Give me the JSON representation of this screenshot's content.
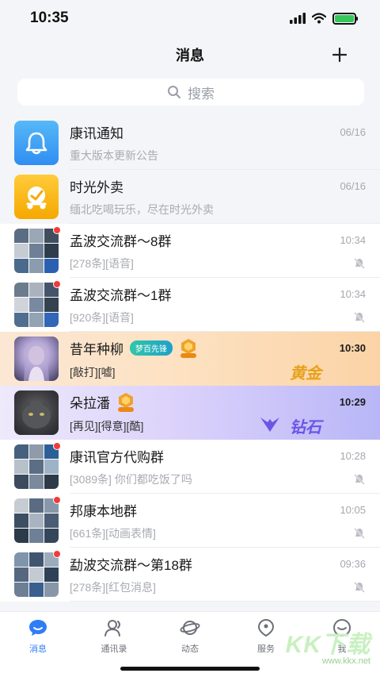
{
  "status_bar": {
    "time": "10:35"
  },
  "nav": {
    "title": "消息",
    "add_icon": "plus-icon"
  },
  "search": {
    "placeholder": "搜索"
  },
  "conversations": [
    {
      "name": "康讯通知",
      "preview": "重大版本更新公告",
      "time": "06/16",
      "avatar": "bell-app-icon",
      "pinned": true
    },
    {
      "name": "时光外卖",
      "preview": "缅北吃喝玩乐，尽在时光外卖",
      "time": "06/16",
      "avatar": "delivery-app-icon",
      "pinned": true
    },
    {
      "name": "孟波交流群～8群",
      "preview": "[278条][语音]",
      "time": "10:34",
      "unread": true,
      "muted": true
    },
    {
      "name": "孟波交流群～1群",
      "preview": "[920条][语音]",
      "time": "10:34",
      "unread": true,
      "muted": true
    },
    {
      "name": "昔年种柳",
      "preview": "[敲打][嘘]",
      "time": "10:30",
      "badge": "梦百先锋",
      "vip": "VIP8",
      "tier": "黄金"
    },
    {
      "name": "朵拉潘",
      "preview": "[再见][得意][酷]",
      "time": "10:29",
      "vip": "VIP8",
      "tier": "钻石"
    },
    {
      "name": "康讯官方代购群",
      "preview": "[3089条] 你们都吃饭了吗",
      "time": "10:28",
      "unread": true,
      "muted": true
    },
    {
      "name": "邦康本地群",
      "preview": "[661条][动画表情]",
      "time": "10:05",
      "unread": true,
      "muted": true
    },
    {
      "name": "勐波交流群～第18群",
      "preview": "[278条][红包消息]",
      "time": "09:36",
      "unread": true,
      "muted": true
    }
  ],
  "tabs": [
    {
      "label": "消息",
      "icon": "chat-icon",
      "active": true
    },
    {
      "label": "通讯录",
      "icon": "contacts-icon"
    },
    {
      "label": "动态",
      "icon": "planet-icon"
    },
    {
      "label": "服务",
      "icon": "service-icon"
    },
    {
      "label": "我",
      "icon": "profile-icon"
    }
  ],
  "watermark": {
    "text": "KK下载",
    "sub": "www.kkx.net"
  },
  "colors": {
    "accent": "#2f7cf6",
    "unread_dot": "#f23a3a",
    "gold_tier": "#e7a21a",
    "diamond_tier": "#6a56e6"
  }
}
